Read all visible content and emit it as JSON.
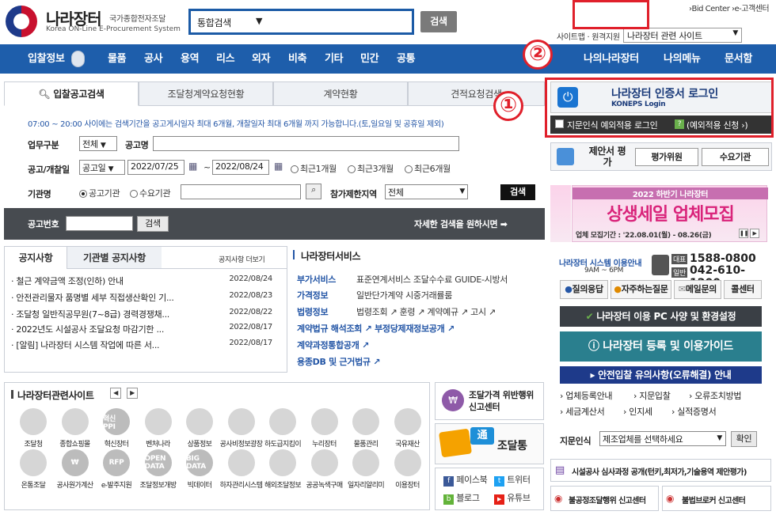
{
  "header": {
    "logo_title": "나라장터",
    "logo_sub_kr": "국가종합전자조달",
    "logo_sub_en": "Korea ON-Line E-Procurement System",
    "search_select": "통합검색",
    "search_button": "검색",
    "top_links": "›Bid Center  ›e-고객센터",
    "sitemap_label": "사이트맵 · 원격지원",
    "related_select": "나라장터 관련 사이트"
  },
  "nav": {
    "items": [
      "입찰정보",
      "물품",
      "공사",
      "용역",
      "리스",
      "외자",
      "비축",
      "기타",
      "민간",
      "공통"
    ],
    "right_items": [
      "나의나라장터",
      "나의메뉴",
      "문서함"
    ]
  },
  "callouts": {
    "one": "①",
    "two": "②"
  },
  "tabs": [
    "입찰공고검색",
    "조달청계약요청현황",
    "계약현황",
    "견적요청검색"
  ],
  "search_form": {
    "notice": "07:00 ~ 20:00 사이에는 검색기간을 공고게시일자 최대 6개월, 개찰일자 최대 6개월 까지 가능합니다.(토,일요일 및 공휴일 제외)",
    "work_type_label": "업무구분",
    "work_type_value": "전체",
    "notice_name_label": "공고명",
    "date_label": "공고/개찰일",
    "date_type_value": "공고일",
    "date_from": "2022/07/25",
    "date_sep": "~",
    "date_to": "2022/08/24",
    "range_options": [
      "최근1개월",
      "최근3개월",
      "최근6개월"
    ],
    "org_label": "기관명",
    "org_options": [
      "공고기관",
      "수요기관"
    ],
    "region_label": "참가제한지역",
    "region_value": "전체",
    "search_button": "검색",
    "notice_no_label": "공고번호",
    "notice_no_button": "검색",
    "detail_search": "자세한 검색을 원하시면 ➡"
  },
  "notices": {
    "tabs": [
      "공지사항",
      "기관별 공지사항"
    ],
    "more": "공지사항 더보기",
    "rows": [
      {
        "title": "· 철근 계약금액 조정(인하) 안내",
        "date": "2022/08/24"
      },
      {
        "title": "· 안전관리물자 품명별 세부 직접생산확인 기...",
        "date": "2022/08/23"
      },
      {
        "title": "· 조달청 일반직공무원(7~8급) 경력경쟁채...",
        "date": "2022/08/22"
      },
      {
        "title": "· 2022년도 시설공사 조달요청 마감기한 ...",
        "date": "2022/08/17"
      },
      {
        "title": "· [알림] 나라장터 시스템 작업에 따른 서...",
        "date": "2022/08/17"
      }
    ]
  },
  "services": {
    "title": "나라장터서비스",
    "rows": [
      {
        "label": "부가서비스",
        "text": "표준연계서비스 조달수수료 GUIDE-시방서"
      },
      {
        "label": "가격정보",
        "text": "일반단가계약 시중거래률룸"
      },
      {
        "label": "법령정보",
        "text": "법령조회 ↗  훈령 ↗  계약예규 ↗  고시 ↗"
      },
      {
        "label": "계약법규 해석조회 ↗  부정당제재정보공개 ↗",
        "text": ""
      },
      {
        "label": "계약과정통합공개 ↗",
        "text": ""
      },
      {
        "label": "용종DB 및 근거법규 ↗",
        "text": ""
      }
    ]
  },
  "related": {
    "title": "나라장터관련사이트",
    "row1": [
      "조달청",
      "종합쇼핑몰",
      "혁신장터",
      "벤처나라",
      "상품정보",
      "공사비정보광장",
      "하도급지킴이",
      "누리장터",
      "물품관리",
      "국유재산"
    ],
    "row2": [
      "온통조달",
      "공사원가계산",
      "e-발주지원",
      "조달정보개방",
      "빅데이터",
      "하자관리시스템",
      "해외조달정보",
      "공공녹색구매",
      "일자리알리미",
      "이용장터"
    ],
    "row1_badges": [
      "",
      "",
      "혁신 PPI",
      "",
      "",
      "",
      "",
      "",
      "",
      ""
    ],
    "row2_badges": [
      "",
      "₩",
      "RFP",
      "OPEN DATA",
      "BIG DATA",
      "",
      "",
      "",
      "",
      ""
    ]
  },
  "mid_promos": {
    "violation": "조달가격 위반행위 신고센터",
    "jodaltong": "조달통",
    "social": [
      "페이스북",
      "트위터",
      "블로그",
      "유튜브"
    ]
  },
  "right": {
    "login_title": "나라장터 인증서 로그인",
    "login_sub": "KONEPS Login",
    "bio_login": "지문인식 예외적용 로그인",
    "bio_apply": "(예외적용 신청 ›)",
    "proposal_title": "제안서 평가",
    "proposal_tabs": [
      "평가위원",
      "수요기관"
    ],
    "banner_top": "2022 하반기 나라장터",
    "banner_main": "상생세일 업체모집",
    "banner_period": "업체 모집기간 : '22.08.01(월) - 08.26(금)",
    "system_guide": "나라장터 시스템 이용안내",
    "hours": "9AM ~ 6PM",
    "phone_main_label": "대표",
    "phone_main": "1588-0800",
    "phone_sub_label": "일반",
    "phone_sub": "042-610-1200",
    "quick_buttons": [
      "질의응답",
      "자주하는질문",
      "메일문의",
      "콜센터"
    ],
    "pc_spec": "나라장터 이용 PC 사양 및 환경설정",
    "reg_guide": "나라장터 등록 및 이용가이드",
    "safe_bid": "안전입찰 유의사항(오류해결) 안내",
    "links": [
      "업체등록안내",
      "지문입찰",
      "오류조치방법",
      "세금계산서",
      "인지세",
      "실적증명서"
    ],
    "fingerprint_label": "지문인식",
    "fingerprint_select": "제조업체를 선택하세요",
    "confirm": "확인",
    "audit": "시설공사 심사과정 공개(턴키,최저가,기술용역 제안평가)",
    "unfair": "불공정조달행위 신고센터",
    "broker": "불법브로커 신고센터"
  }
}
